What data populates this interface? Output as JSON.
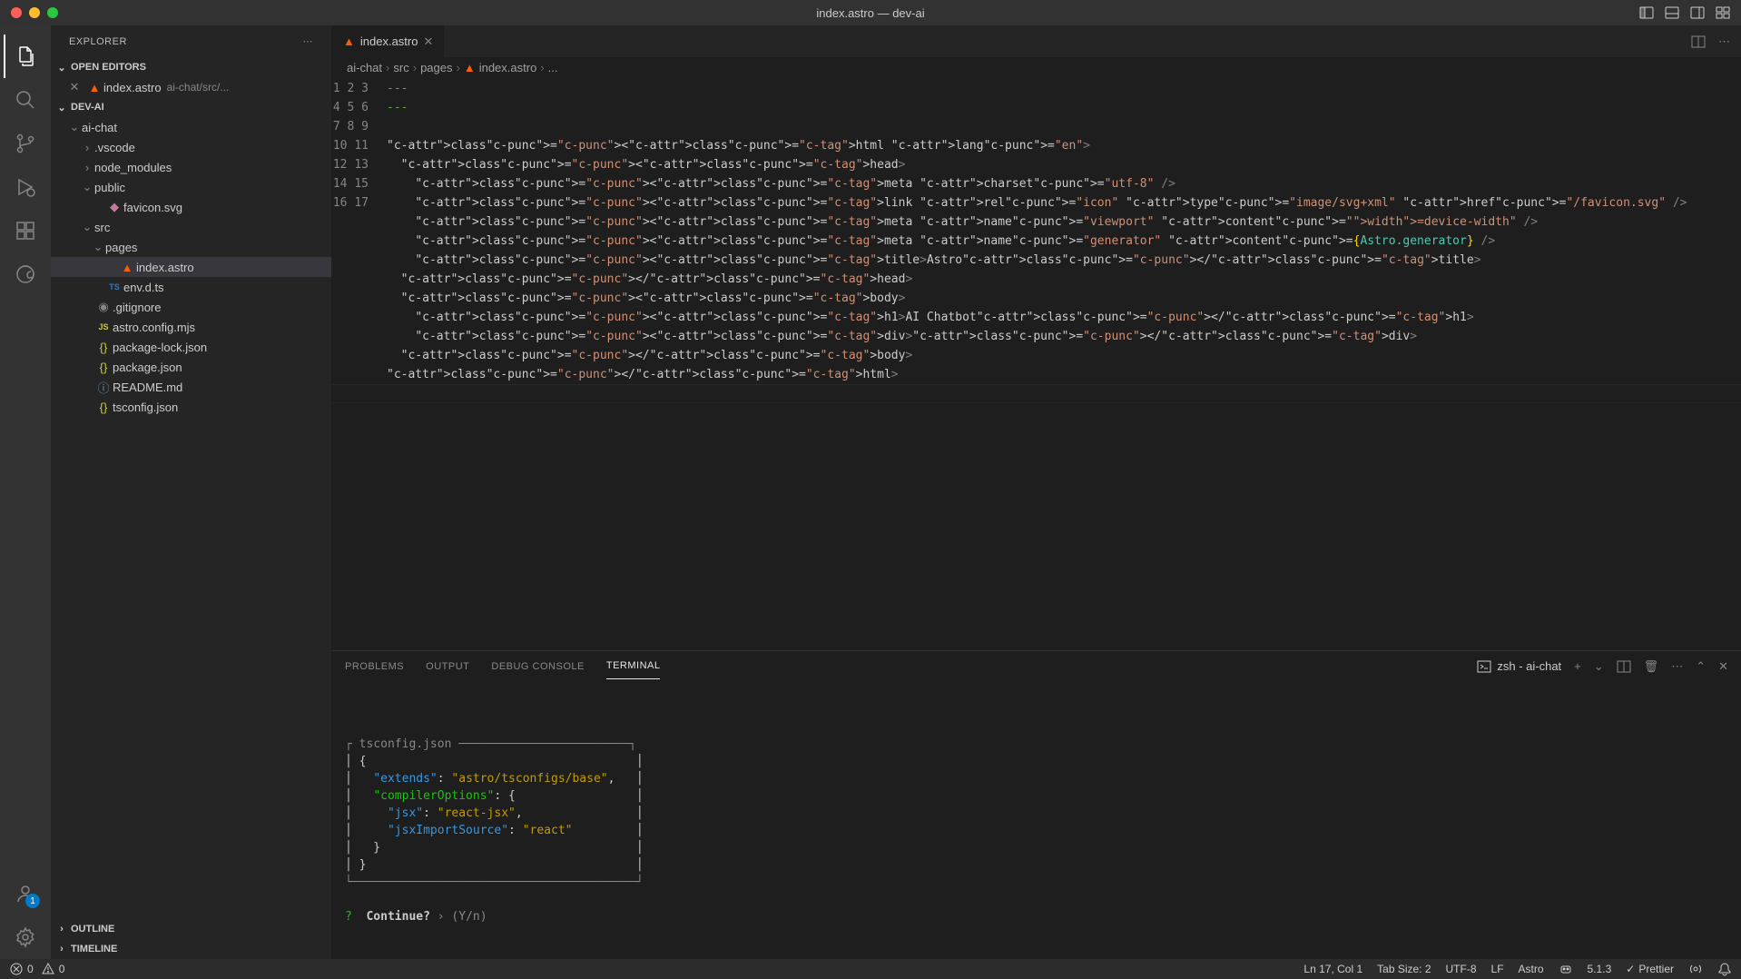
{
  "window": {
    "title": "index.astro — dev-ai"
  },
  "sidebar": {
    "title": "EXPLORER",
    "sections": {
      "openEditors": "OPEN EDITORS",
      "project": "DEV-AI",
      "outline": "OUTLINE",
      "timeline": "TIMELINE"
    },
    "openEditor": {
      "name": "index.astro",
      "path": "ai-chat/src/..."
    },
    "tree": {
      "aiChat": "ai-chat",
      "vscode": ".vscode",
      "nodeModules": "node_modules",
      "public": "public",
      "favicon": "favicon.svg",
      "src": "src",
      "pages": "pages",
      "indexAstro": "index.astro",
      "envdts": "env.d.ts",
      "gitignore": ".gitignore",
      "astroConfig": "astro.config.mjs",
      "pkgLock": "package-lock.json",
      "pkg": "package.json",
      "readme": "README.md",
      "tsconfig": "tsconfig.json"
    }
  },
  "tab": {
    "name": "index.astro"
  },
  "breadcrumbs": [
    "ai-chat",
    "src",
    "pages",
    "index.astro",
    "..."
  ],
  "editor": {
    "lines": [
      "---",
      "---",
      "",
      "<html lang=\"en\">",
      "  <head>",
      "    <meta charset=\"utf-8\" />",
      "    <link rel=\"icon\" type=\"image/svg+xml\" href=\"/favicon.svg\" />",
      "    <meta name=\"viewport\" content=\"width=device-width\" />",
      "    <meta name=\"generator\" content={Astro.generator} />",
      "    <title>Astro</title>",
      "  </head>",
      "  <body>",
      "    <h1>AI Chatbot</h1>",
      "    <div></div>",
      "  </body>",
      "</html>",
      ""
    ]
  },
  "panel": {
    "tabs": {
      "problems": "PROBLEMS",
      "output": "OUTPUT",
      "debug": "DEBUG CONSOLE",
      "terminal": "TERMINAL"
    },
    "terminalName": "zsh - ai-chat",
    "terminal": {
      "boxTitle": "tsconfig.json",
      "l1": "{",
      "l2_key": "\"extends\"",
      "l2_val": "\"astro/tsconfigs/base\"",
      "l3_key": "\"compilerOptions\"",
      "l3_brace": "{",
      "l4_key": "\"jsx\"",
      "l4_val": "\"react-jsx\"",
      "l5_key": "\"jsxImportSource\"",
      "l5_val": "\"react\"",
      "l6": "  }",
      "l7": "}",
      "promptQ": "?",
      "promptText": "Continue?",
      "promptArrow": "›",
      "promptHint": "(Y/n)"
    }
  },
  "status": {
    "errors": "0",
    "warnings": "0",
    "ln": "Ln 17, Col 1",
    "tab": "Tab Size: 2",
    "enc": "UTF-8",
    "eol": "LF",
    "lang": "Astro",
    "ver": "5.1.3",
    "prettier": "Prettier"
  },
  "accountBadge": "1"
}
